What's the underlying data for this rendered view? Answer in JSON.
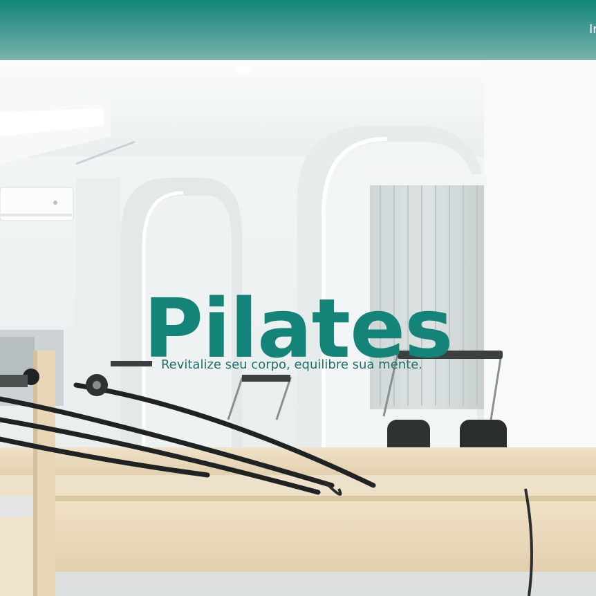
{
  "header": {
    "nav_item_partial": "In"
  },
  "hero": {
    "title": "Pilates",
    "subtitle": "Revitalize seu corpo, equilibre sua mente."
  },
  "colors": {
    "header_top": "#138679",
    "header_bottom": "#7db2ae",
    "title": "#158478",
    "subtitle": "#1f6f68"
  }
}
